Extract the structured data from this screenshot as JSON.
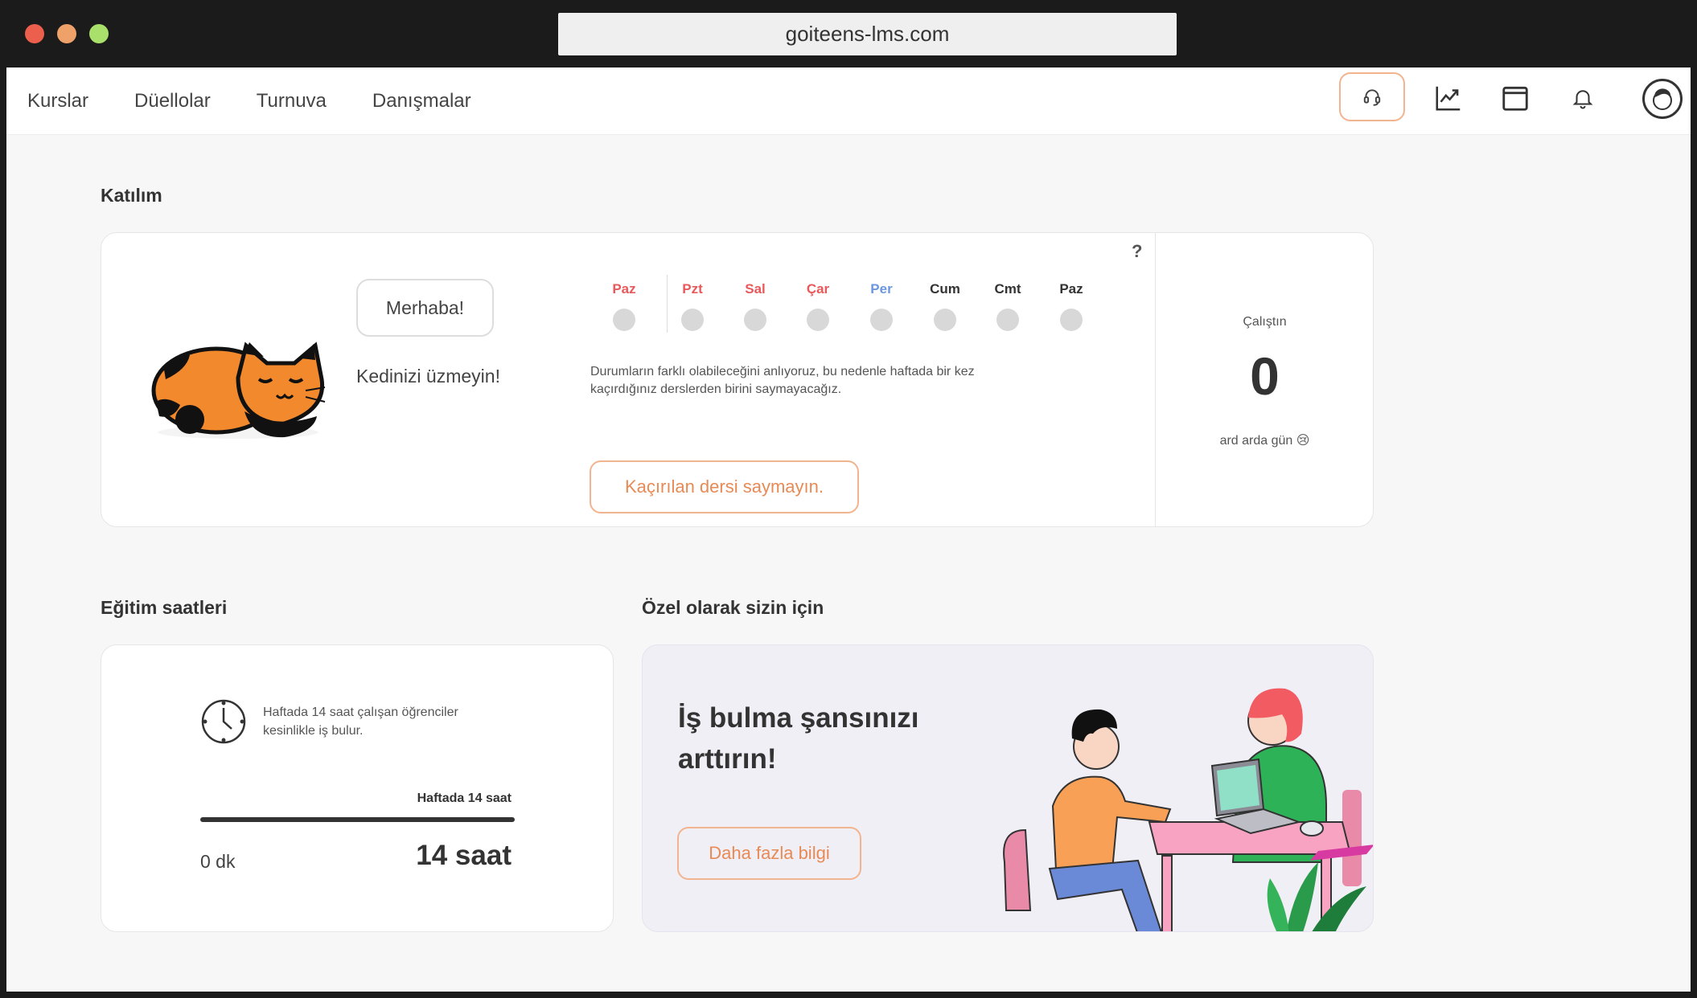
{
  "browser": {
    "url": "goiteens-lms.com"
  },
  "nav": {
    "links": [
      "Kurslar",
      "Düellolar",
      "Turnuva",
      "Danışmalar"
    ]
  },
  "attendance": {
    "section_title": "Katılım",
    "help": "?",
    "greeting": "Merhaba!",
    "cat_message": "Kedinizi üzmeyin!",
    "days": [
      {
        "label": "Paz",
        "color": "#e8595b"
      },
      {
        "label": "Pzt",
        "color": "#e8595b"
      },
      {
        "label": "Sal",
        "color": "#e8595b"
      },
      {
        "label": "Çar",
        "color": "#e8595b"
      },
      {
        "label": "Per",
        "color": "#6c97e0"
      },
      {
        "label": "Cum",
        "color": "#333333"
      },
      {
        "label": "Cmt",
        "color": "#333333"
      },
      {
        "label": "Paz",
        "color": "#333333"
      }
    ],
    "description": "Durumların farklı olabileceğini anlıyoruz, bu nedenle haftada bir kez kaçırdığınız derslerden birini saymayacağız.",
    "skip_button": "Kaçırılan dersi saymayın.",
    "streak": {
      "label": "Çalıştın",
      "value": "0",
      "sub": "ard arda gün 😢"
    }
  },
  "training_hours": {
    "section_title": "Eğitim saatleri",
    "description": "Haftada 14 saat çalışan öğrenciler kesinlikle iş bulur.",
    "goal_label": "Haftada 14 saat",
    "progress": 0,
    "min_label": "0 dk",
    "max_label": "14 saat"
  },
  "promo": {
    "section_title": "Özel olarak sizin için",
    "title": "İş bulma şansınızı arttırın!",
    "button": "Daha fazla bilgi"
  },
  "colors": {
    "accent": "#f08a4b",
    "accent_border": "#f2b48e",
    "cat_orange": "#f2892c"
  }
}
